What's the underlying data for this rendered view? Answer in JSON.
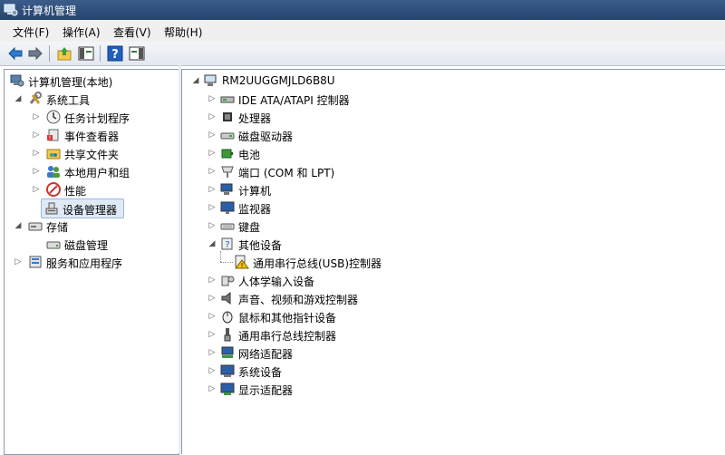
{
  "window": {
    "title": "计算机管理"
  },
  "menu": {
    "file": "文件(F)",
    "action": "操作(A)",
    "view": "查看(V)",
    "help": "帮助(H)"
  },
  "toolbar": {
    "buttons": [
      "back-icon",
      "forward-icon",
      "up-icon",
      "show-hide-tree-icon",
      "help-icon",
      "show-hide-action-pane-icon"
    ]
  },
  "tree": {
    "root": "计算机管理(本地)",
    "system_tools": "系统工具",
    "task_scheduler": "任务计划程序",
    "event_viewer": "事件查看器",
    "shared_folders": "共享文件夹",
    "local_users": "本地用户和组",
    "performance": "性能",
    "device_manager": "设备管理器",
    "storage": "存储",
    "disk_management": "磁盘管理",
    "services_apps": "服务和应用程序",
    "selected": "设备管理器"
  },
  "devices": {
    "computer_name": "RM2UUGGMJLD6B8U",
    "categories": [
      {
        "label": "IDE ATA/ATAPI 控制器",
        "icon": "ide-controller-icon",
        "expanded": false
      },
      {
        "label": "处理器",
        "icon": "processor-icon",
        "expanded": false
      },
      {
        "label": "磁盘驱动器",
        "icon": "disk-drive-icon",
        "expanded": false
      },
      {
        "label": "电池",
        "icon": "battery-icon",
        "expanded": false
      },
      {
        "label": "端口 (COM 和 LPT)",
        "icon": "port-icon",
        "expanded": false
      },
      {
        "label": "计算机",
        "icon": "computer-icon",
        "expanded": false
      },
      {
        "label": "监视器",
        "icon": "monitor-icon",
        "expanded": false
      },
      {
        "label": "键盘",
        "icon": "keyboard-icon",
        "expanded": false
      },
      {
        "label": "其他设备",
        "icon": "unknown-device-icon",
        "expanded": true
      },
      {
        "label": "人体学输入设备",
        "icon": "hid-icon",
        "expanded": false
      },
      {
        "label": "声音、视频和游戏控制器",
        "icon": "sound-icon",
        "expanded": false
      },
      {
        "label": "鼠标和其他指针设备",
        "icon": "mouse-icon",
        "expanded": false
      },
      {
        "label": "通用串行总线控制器",
        "icon": "usb-icon",
        "expanded": false
      },
      {
        "label": "网络适配器",
        "icon": "network-adapter-icon",
        "expanded": false
      },
      {
        "label": "系统设备",
        "icon": "system-device-icon",
        "expanded": false
      },
      {
        "label": "显示适配器",
        "icon": "display-adapter-icon",
        "expanded": false
      }
    ],
    "other_devices_child": "通用串行总线(USB)控制器"
  }
}
